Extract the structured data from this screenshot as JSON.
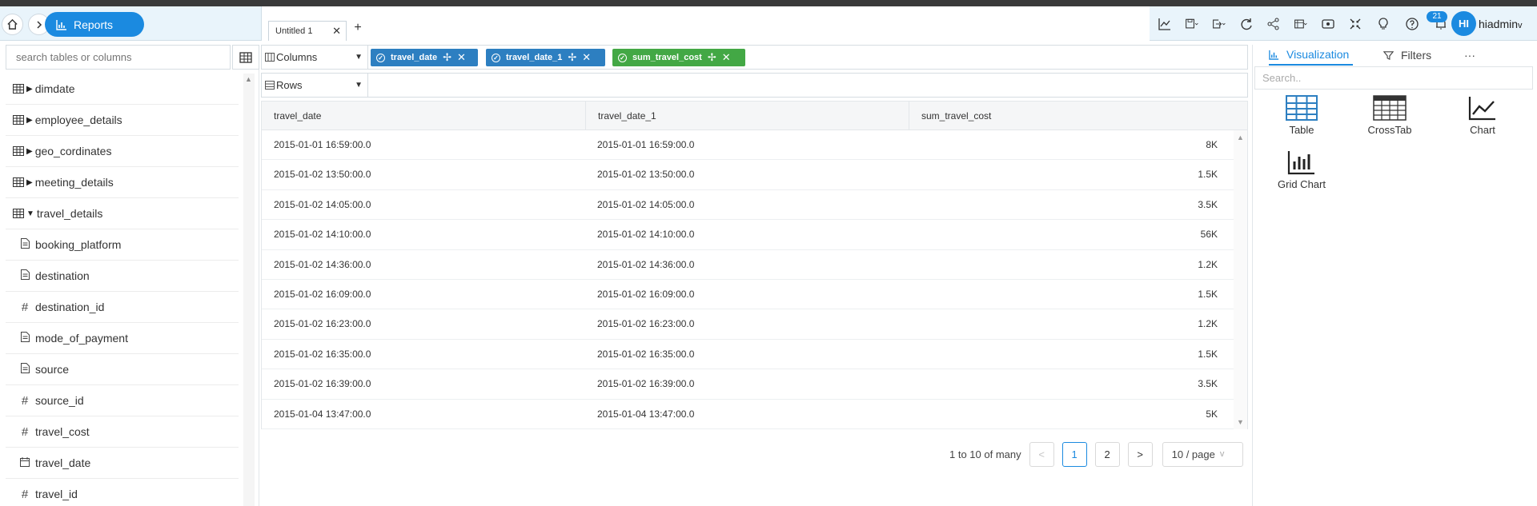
{
  "header": {
    "app_button": "Reports",
    "tab_title": "Untitled 1",
    "notification_count": "21",
    "avatar_initials": "HI",
    "username": "hiadmin"
  },
  "sidebar": {
    "search_placeholder": "search tables or columns",
    "items": [
      {
        "label": "dimdate",
        "kind": "table",
        "expanded": false
      },
      {
        "label": "employee_details",
        "kind": "table",
        "expanded": false
      },
      {
        "label": "geo_cordinates",
        "kind": "table",
        "expanded": false
      },
      {
        "label": "meeting_details",
        "kind": "table",
        "expanded": false
      },
      {
        "label": "travel_details",
        "kind": "table",
        "expanded": true
      },
      {
        "label": "booking_platform",
        "kind": "text"
      },
      {
        "label": "destination",
        "kind": "text"
      },
      {
        "label": "destination_id",
        "kind": "number"
      },
      {
        "label": "mode_of_payment",
        "kind": "text"
      },
      {
        "label": "source",
        "kind": "text"
      },
      {
        "label": "source_id",
        "kind": "number"
      },
      {
        "label": "travel_cost",
        "kind": "number"
      },
      {
        "label": "travel_date",
        "kind": "date"
      },
      {
        "label": "travel_id",
        "kind": "number"
      }
    ]
  },
  "shelves": {
    "columns_label": "Columns",
    "rows_label": "Rows",
    "column_pills": [
      "travel_date",
      "travel_date_1",
      "sum_travel_cost"
    ]
  },
  "grid": {
    "headers": [
      "travel_date",
      "travel_date_1",
      "sum_travel_cost"
    ],
    "rows": [
      [
        "2015-01-01 16:59:00.0",
        "2015-01-01 16:59:00.0",
        "8K"
      ],
      [
        "2015-01-02 13:50:00.0",
        "2015-01-02 13:50:00.0",
        "1.5K"
      ],
      [
        "2015-01-02 14:05:00.0",
        "2015-01-02 14:05:00.0",
        "3.5K"
      ],
      [
        "2015-01-02 14:10:00.0",
        "2015-01-02 14:10:00.0",
        "56K"
      ],
      [
        "2015-01-02 14:36:00.0",
        "2015-01-02 14:36:00.0",
        "1.2K"
      ],
      [
        "2015-01-02 16:09:00.0",
        "2015-01-02 16:09:00.0",
        "1.5K"
      ],
      [
        "2015-01-02 16:23:00.0",
        "2015-01-02 16:23:00.0",
        "1.2K"
      ],
      [
        "2015-01-02 16:35:00.0",
        "2015-01-02 16:35:00.0",
        "1.5K"
      ],
      [
        "2015-01-02 16:39:00.0",
        "2015-01-02 16:39:00.0",
        "3.5K"
      ],
      [
        "2015-01-04 13:47:00.0",
        "2015-01-04 13:47:00.0",
        "5K"
      ]
    ]
  },
  "pagination": {
    "summary": "1 to 10 of many",
    "pages": [
      "1",
      "2"
    ],
    "current_page": "1",
    "per_page": "10 / page"
  },
  "right_panel": {
    "tabs": [
      "Visualization",
      "Filters"
    ],
    "more": "···",
    "search_placeholder": "Search..",
    "visualizations": [
      "Table",
      "CrossTab",
      "Chart",
      "Grid Chart"
    ]
  },
  "colors": {
    "accent": "#1b8ae0",
    "pill_blue": "#2d7fc1",
    "pill_green": "#43a845",
    "topbar_bg": "#e9f4fb"
  }
}
